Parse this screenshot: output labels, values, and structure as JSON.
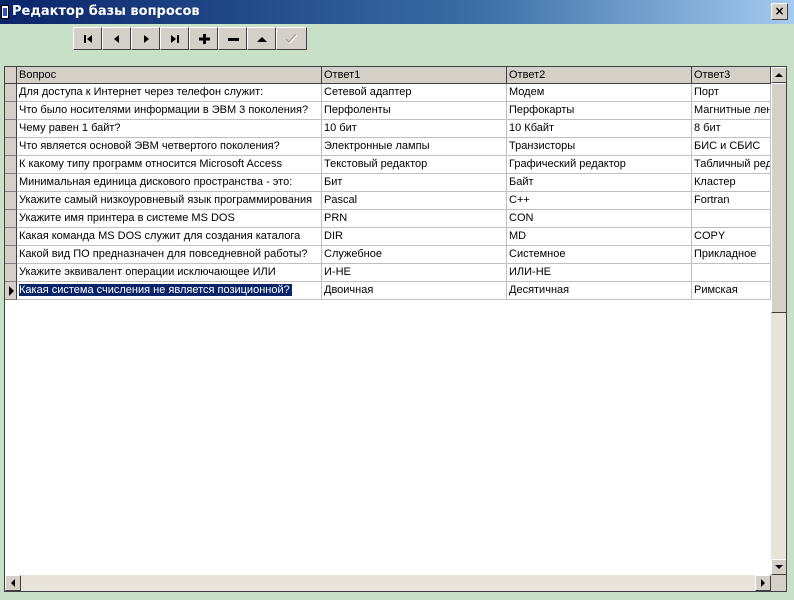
{
  "window": {
    "title": "Редактор базы вопросов",
    "close_glyph": "×"
  },
  "navigator": {
    "buttons": [
      {
        "name": "first-record-button",
        "icon": "first-record-icon",
        "enabled": true
      },
      {
        "name": "prior-record-button",
        "icon": "prior-record-icon",
        "enabled": true
      },
      {
        "name": "next-record-button",
        "icon": "next-record-icon",
        "enabled": true
      },
      {
        "name": "last-record-button",
        "icon": "last-record-icon",
        "enabled": true
      },
      {
        "name": "insert-record-button",
        "icon": "plus-icon",
        "enabled": true
      },
      {
        "name": "delete-record-button",
        "icon": "minus-icon",
        "enabled": true
      },
      {
        "name": "edit-record-button",
        "icon": "edit-triangle-icon",
        "enabled": true
      },
      {
        "name": "post-record-button",
        "icon": "checkmark-icon",
        "enabled": false
      }
    ]
  },
  "grid": {
    "columns": [
      "Вопрос",
      "Ответ1",
      "Ответ2",
      "Ответ3"
    ],
    "rows": [
      [
        "Для доступа к Интернет через телефон служит:",
        "Сетевой адаптер",
        "Модем",
        "Порт"
      ],
      [
        "Что было носителями информации в ЭВМ 3 поколения?",
        "Перфоленты",
        "Перфокарты",
        "Магнитные лен"
      ],
      [
        "Чему равен 1 байт?",
        "10 бит",
        "10 Кбайт",
        "8 бит"
      ],
      [
        "Что является основой ЭВМ четвертого поколения?",
        "Электронные лампы",
        "Транзисторы",
        "БИС и СБИС"
      ],
      [
        "К какому типу программ относится Microsoft Access",
        "Текстовый редактор",
        "Графический редактор",
        "Табличный ред"
      ],
      [
        "Минимальная единица дискового пространства - это:",
        "Бит",
        "Байт",
        "Кластер"
      ],
      [
        "Укажите самый низкоуровневый язык программирования",
        "Pascal",
        "C++",
        "Fortran"
      ],
      [
        "Укажите имя принтера в системе MS DOS",
        "PRN",
        "CON",
        ""
      ],
      [
        "Какая команда MS DOS служит для создания каталога",
        "DIR",
        "MD",
        "COPY"
      ],
      [
        "Какой вид ПО предназначен для повседневной работы?",
        "Служебное",
        "Системное",
        "Прикладное"
      ],
      [
        "Укажите эквивалент операции исключающее ИЛИ",
        "И-НЕ",
        "ИЛИ-НЕ",
        ""
      ],
      [
        "Какая система счисления не является позиционной?",
        "Двоичная",
        "Десятичная",
        "Римская"
      ]
    ],
    "current_row": 11
  },
  "colors": {
    "titlebar_start": "#0a246a",
    "client_bg": "#c8e0c8",
    "selection": "#0a246a",
    "face": "#d4d0c8"
  }
}
